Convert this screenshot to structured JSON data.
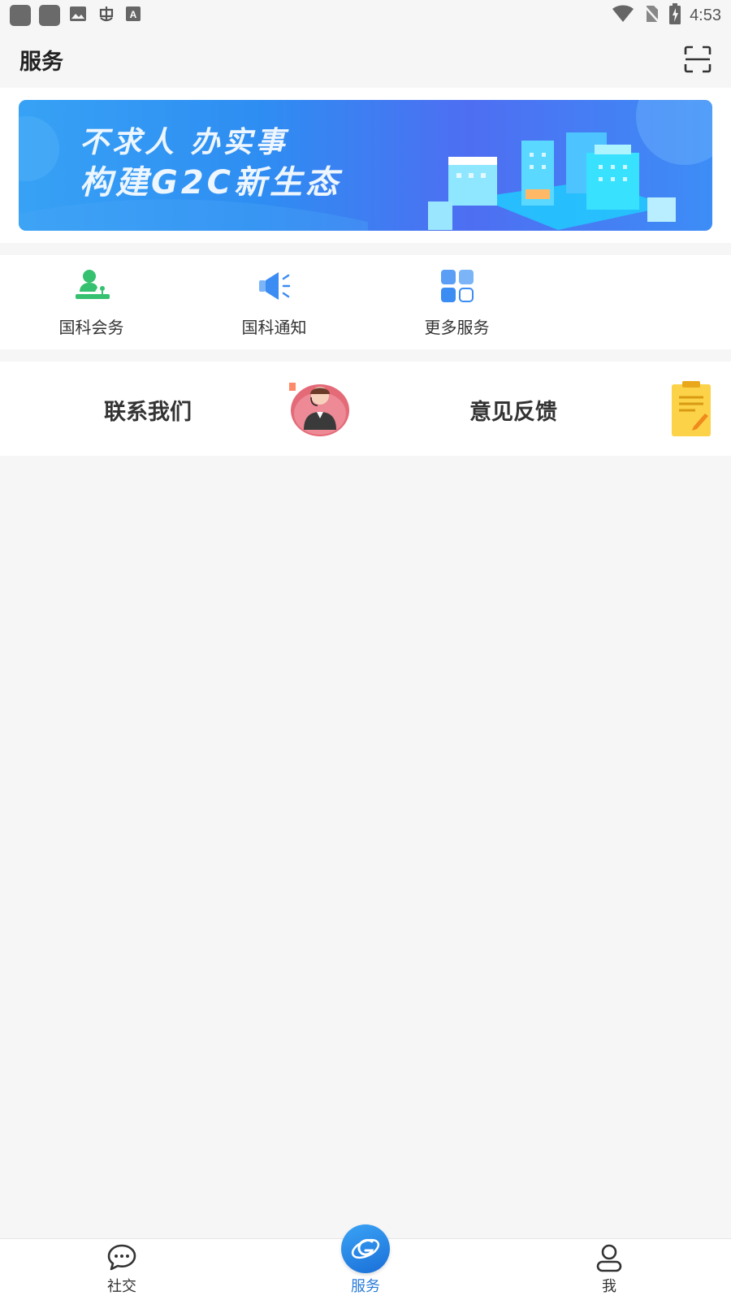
{
  "status_bar": {
    "time": "4:53",
    "left_icons": [
      "app-icon",
      "app-icon",
      "image-icon",
      "bug-icon",
      "text-icon"
    ],
    "right_icons": [
      "wifi-icon",
      "no-sim-icon",
      "battery-charging-icon"
    ]
  },
  "header": {
    "title": "服务",
    "scan_icon": "scan-icon"
  },
  "banner": {
    "line1": "不求人 办实事",
    "line2": "构建G2C新生态",
    "colors": {
      "start": "#37a2f5",
      "end": "#4e6ef2"
    }
  },
  "services": [
    {
      "label": "国科会务",
      "icon": "meeting-speaker-icon",
      "color": "#35c16f"
    },
    {
      "label": "国科通知",
      "icon": "megaphone-icon",
      "color": "#3b8cf3"
    },
    {
      "label": "更多服务",
      "icon": "grid-apps-icon",
      "color": "#3b8cf3"
    }
  ],
  "cards": {
    "contact": {
      "label": "联系我们",
      "icon": "customer-service-icon"
    },
    "feedback": {
      "label": "意见反馈",
      "icon": "clipboard-note-icon"
    }
  },
  "bottom_nav": {
    "items": [
      {
        "label": "社交",
        "icon": "chat-bubble-icon"
      },
      {
        "label": "服务",
        "icon": "service-logo-icon",
        "active": true
      },
      {
        "label": "我",
        "icon": "user-icon"
      }
    ],
    "active_color": "#2a7bd8"
  }
}
